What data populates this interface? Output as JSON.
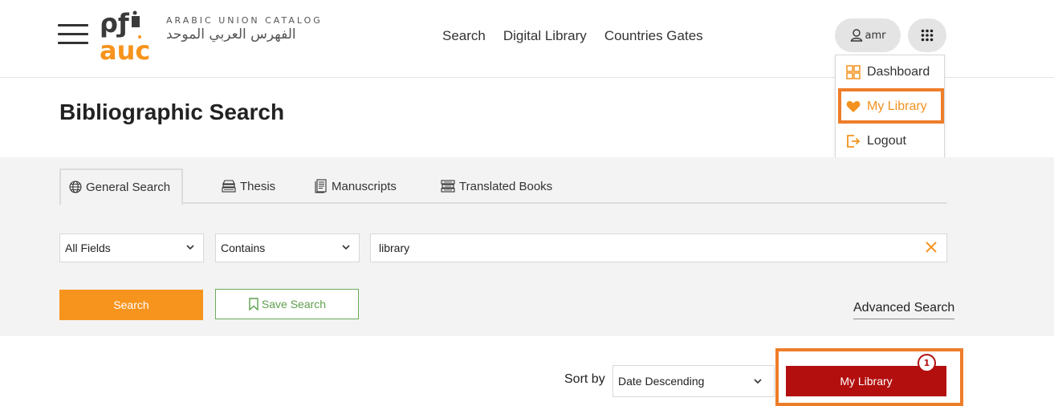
{
  "header": {
    "logo_en": "ARABIC UNION CATALOG",
    "logo_ar": "الفهرس العربي الموحد",
    "nav": [
      "Search",
      "Digital Library",
      "Countries Gates"
    ],
    "user_label": "amr"
  },
  "user_menu": {
    "items": [
      {
        "label": "Dashboard",
        "icon": "dashboard-icon"
      },
      {
        "label": "My Library",
        "icon": "heart-icon"
      },
      {
        "label": "Logout",
        "icon": "logout-icon"
      }
    ]
  },
  "page": {
    "title": "Bibliographic Search"
  },
  "search": {
    "tabs": [
      {
        "label": "General Search",
        "icon": "globe-icon",
        "active": true
      },
      {
        "label": "Thesis",
        "icon": "thesis-icon",
        "active": false
      },
      {
        "label": "Manuscripts",
        "icon": "manuscript-icon",
        "active": false
      },
      {
        "label": "Translated Books",
        "icon": "books-icon",
        "active": false
      }
    ],
    "field_select": "All Fields",
    "operator_select": "Contains",
    "query": "library",
    "search_button": "Search",
    "save_button": "Save Search",
    "advanced_link": "Advanced Search"
  },
  "results_bar": {
    "sort_label": "Sort by",
    "sort_value": "Date Descending",
    "my_library_button": "My Library",
    "my_library_count": "1"
  },
  "colors": {
    "accent_orange": "#f7941d",
    "save_green": "#5fa04e",
    "library_red": "#b30f0f",
    "highlight_orange": "#ee7d2a"
  }
}
